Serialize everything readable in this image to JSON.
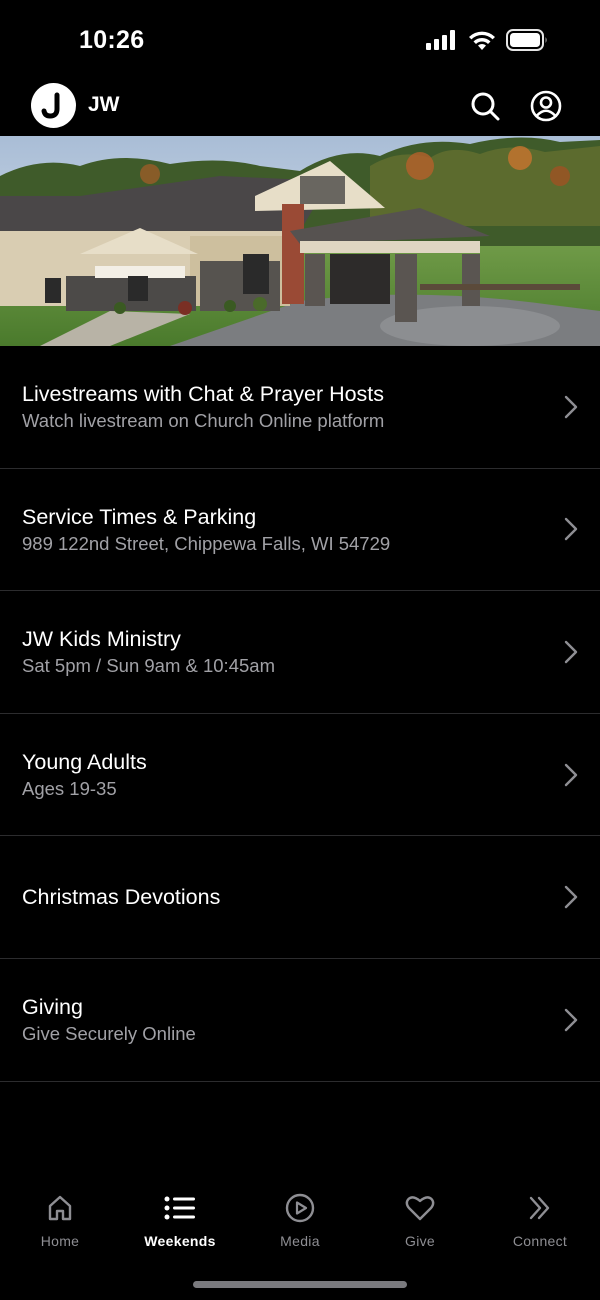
{
  "status": {
    "time": "10:26",
    "icons": [
      "cellular-signal-icon",
      "wifi-icon",
      "battery-icon"
    ]
  },
  "header": {
    "logo_letter": "J",
    "title": "JW",
    "icons": [
      "search-icon",
      "account-icon"
    ]
  },
  "menu": {
    "items": [
      {
        "title": "Livestreams with Chat & Prayer Hosts",
        "subtitle": "Watch livestream on Church Online platform"
      },
      {
        "title": "Service Times & Parking",
        "subtitle": "989 122nd Street, Chippewa Falls, WI 54729"
      },
      {
        "title": "JW Kids Ministry",
        "subtitle": "Sat 5pm / Sun 9am & 10:45am"
      },
      {
        "title": "Young Adults",
        "subtitle": "Ages 19-35"
      },
      {
        "title": "Christmas Devotions",
        "subtitle": ""
      },
      {
        "title": "Giving",
        "subtitle": "Give Securely Online"
      }
    ]
  },
  "tabs": {
    "home": "Home",
    "weekends": "Weekends",
    "media": "Media",
    "give": "Give",
    "connect": "Connect",
    "active": "weekends"
  },
  "colors": {
    "background": "#000000",
    "text": "#ffffff",
    "secondary_text": "#a1a1a6",
    "inactive_tab": "#8e8e93",
    "divider": "#2c2c2e"
  }
}
